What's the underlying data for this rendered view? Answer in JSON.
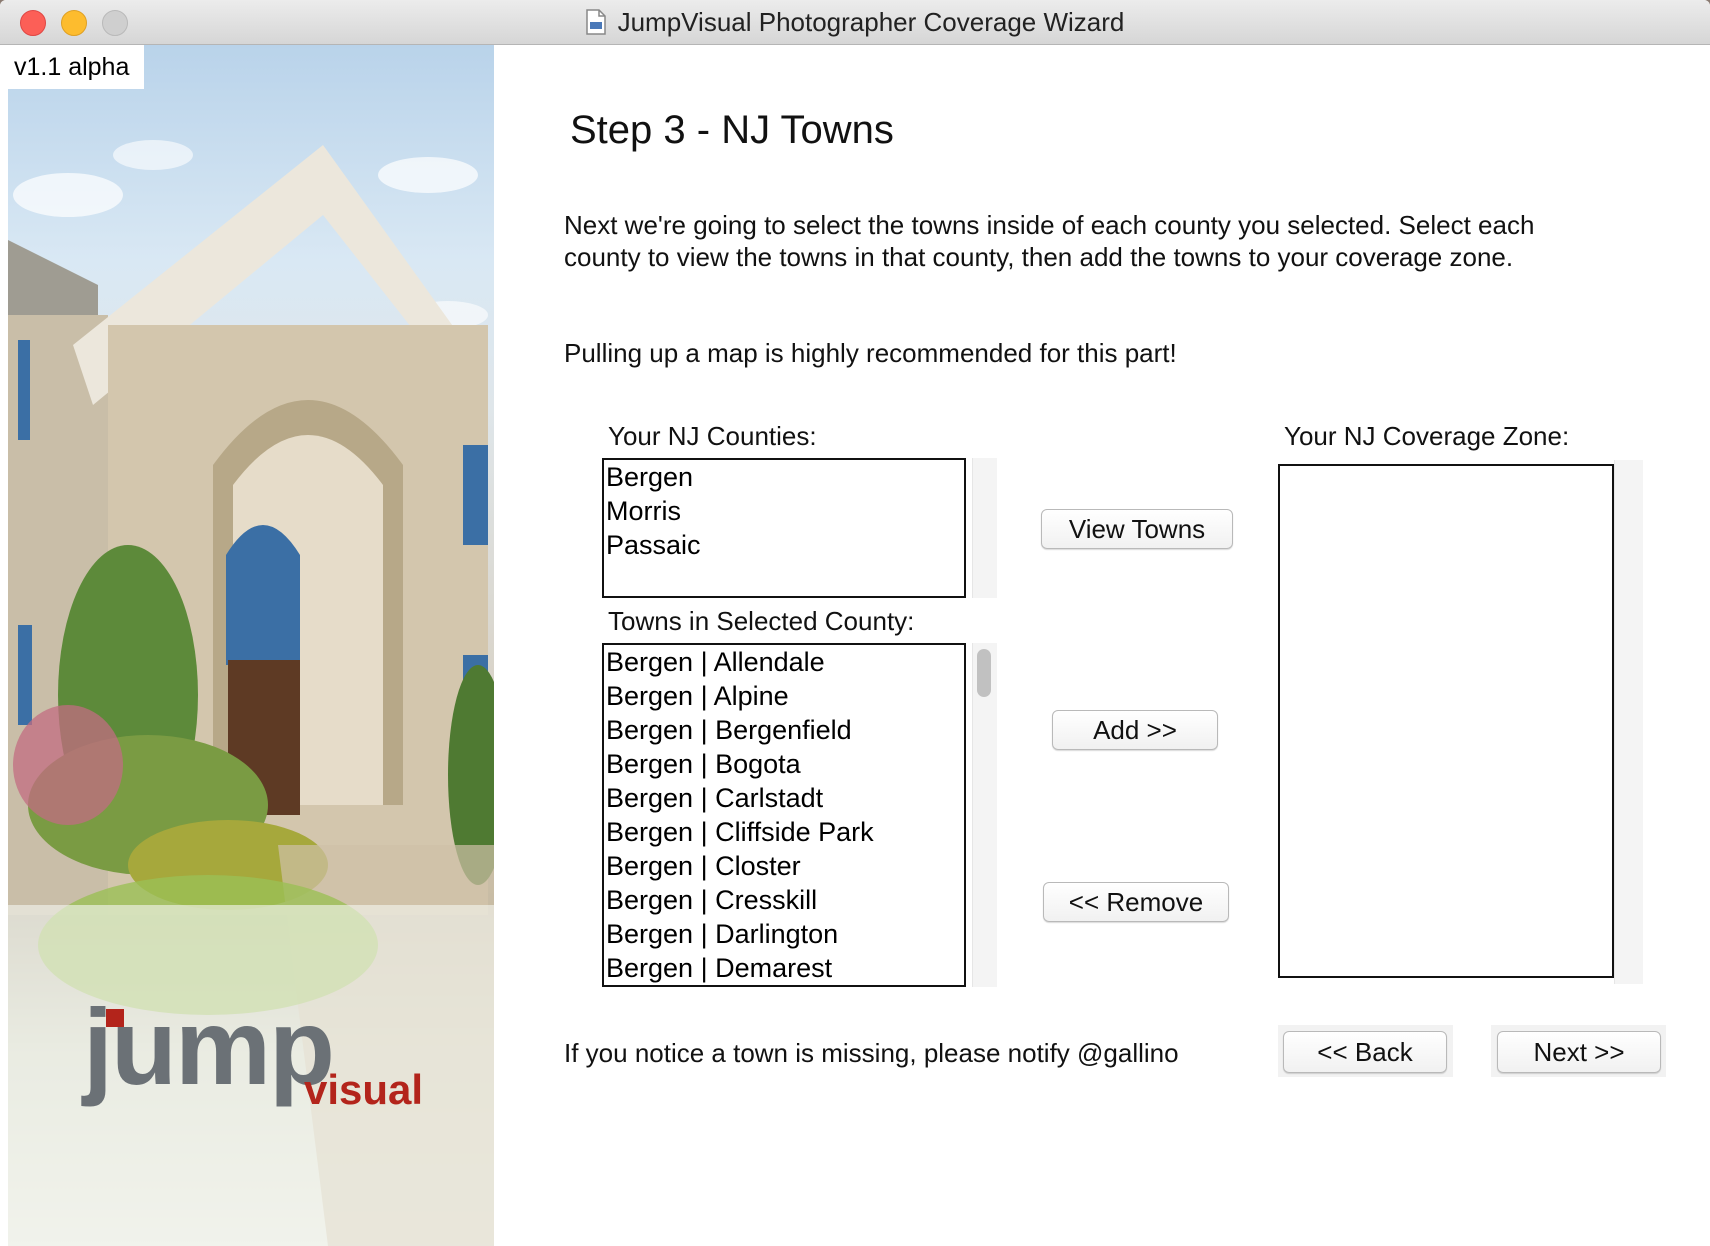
{
  "window": {
    "title": "JumpVisual Photographer Coverage Wizard"
  },
  "sidebar": {
    "version": "v1.1 alpha",
    "logo_text_1": "jump",
    "logo_text_2": "visual"
  },
  "step": {
    "title": "Step 3 - NJ Towns",
    "intro": "Next we're going to select the towns inside of each county you selected. Select each county to view the towns in that county, then add the towns to your coverage zone.",
    "hint": "Pulling up a map is highly recommended for this part!"
  },
  "counties": {
    "label": "Your NJ Counties:",
    "items": [
      "Bergen",
      "Morris",
      "Passaic"
    ]
  },
  "towns": {
    "label": "Towns in Selected County:",
    "items": [
      "Bergen | Allendale",
      "Bergen | Alpine",
      "Bergen | Bergenfield",
      "Bergen | Bogota",
      "Bergen | Carlstadt",
      "Bergen | Cliffside Park",
      "Bergen | Closter",
      "Bergen | Cresskill",
      "Bergen | Darlington",
      "Bergen | Demarest"
    ]
  },
  "coverage": {
    "label": "Your NJ Coverage Zone:",
    "items": []
  },
  "buttons": {
    "view_towns": "View Towns",
    "add": "Add >>",
    "remove": "<< Remove",
    "back": "<< Back",
    "next": "Next >>"
  },
  "footer": {
    "note": "If you notice a town is missing, please notify @gallino"
  }
}
